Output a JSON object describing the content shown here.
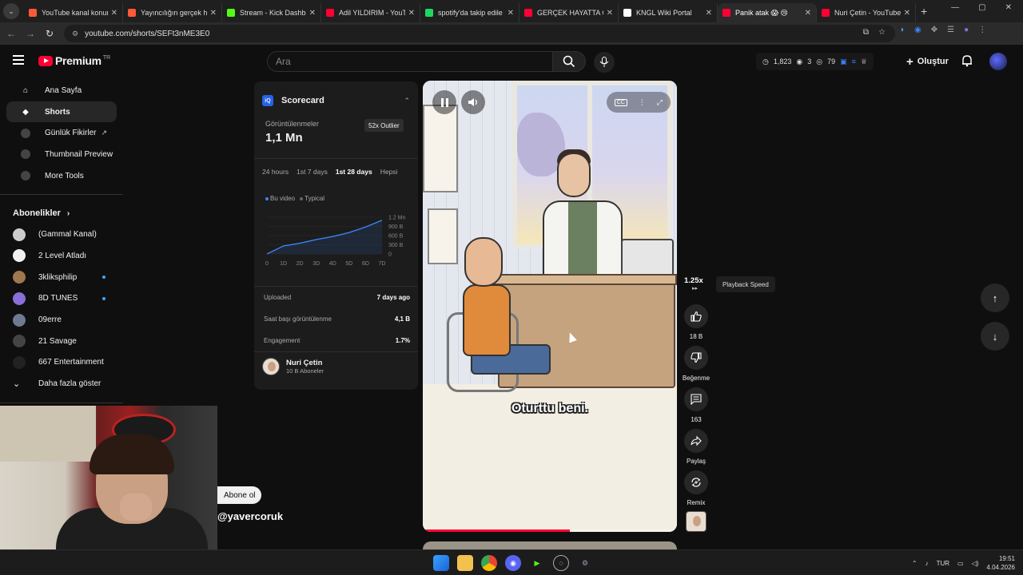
{
  "browser": {
    "tabs": [
      {
        "title": "YouTube kanal konum",
        "color": "#ff5a36"
      },
      {
        "title": "Yayıncılığın gerçek h",
        "color": "#ff5a36"
      },
      {
        "title": "Stream - Kick Dashbo",
        "color": "#53fc18"
      },
      {
        "title": "Adil YILDIRIM - YouTu",
        "color": "#ff0033"
      },
      {
        "title": "spotify'da takip edile",
        "color": "#1ed760"
      },
      {
        "title": "GERÇEK HAYATTA OY",
        "color": "#ff0033"
      },
      {
        "title": "KNGL Wiki Portal",
        "color": "#ffffff"
      },
      {
        "title": "Panik atak 😱 😢",
        "color": "#ff0033",
        "active": true
      },
      {
        "title": "Nuri Çetin - YouTube",
        "color": "#ff0033"
      }
    ],
    "url": "youtube.com/shorts/SEFt3nME3E0"
  },
  "header": {
    "logo_text": "Premium",
    "logo_country": "TR",
    "search_placeholder": "Ara",
    "stats": {
      "time": "1,823",
      "eye": "3",
      "views": "79"
    },
    "create_label": "Oluştur"
  },
  "sidebar": {
    "items": [
      {
        "label": "Ana Sayfa",
        "icon": "home-icon"
      },
      {
        "label": "Shorts",
        "icon": "shorts-icon"
      },
      {
        "label": "Günlük Fikirler",
        "icon": "tool-icon"
      },
      {
        "label": "Thumbnail Preview",
        "icon": "tool-icon"
      },
      {
        "label": "More Tools",
        "icon": "tool-icon"
      }
    ],
    "subs_title": "Abonelikler",
    "subs": [
      {
        "label": "(Gammal Kanal)",
        "color": "#cccccc"
      },
      {
        "label": "2 Level Atladı",
        "color": "#f1f1f1"
      },
      {
        "label": "3kliksphilip",
        "color": "#a07850",
        "dot": true
      },
      {
        "label": "8D TUNES",
        "color": "#8a6fd8",
        "dot": true
      },
      {
        "label": "09erre",
        "color": "#6e7a90"
      },
      {
        "label": "21 Savage",
        "color": "#444444"
      },
      {
        "label": "667 Entertainment",
        "color": "#222222"
      }
    ],
    "more_label": "Daha fazla göster"
  },
  "scorecard": {
    "title": "Scorecard",
    "views_label": "Görüntülenmeler",
    "views_value": "1,1 Mn",
    "outlier": "52x Outlier",
    "tabs": [
      "24 hours",
      "1st 7 days",
      "1st 28 days",
      "Hepsi"
    ],
    "active_tab": 2,
    "legend_video": "Bu video",
    "legend_typical": "Typical",
    "rows": [
      {
        "label": "Uploaded",
        "value": "7 days ago"
      },
      {
        "label": "Saat başı görüntülenme",
        "value": "4,1 B"
      },
      {
        "label": "Engagement",
        "value": "1.7%"
      }
    ],
    "channel_name": "Nuri Çetin",
    "channel_subs": "10 B Aboneler"
  },
  "chart_data": {
    "type": "line",
    "x": [
      "0",
      "1D",
      "2D",
      "3D",
      "4D",
      "5D",
      "6D",
      "7D"
    ],
    "y_ticks": [
      "1.2 Mn",
      "900 B",
      "600 B",
      "300 B",
      "0"
    ],
    "ylim": [
      0,
      1200000
    ],
    "series": [
      {
        "name": "Bu video",
        "values": [
          0,
          260000,
          350000,
          470000,
          570000,
          700000,
          880000,
          1100000
        ],
        "color": "#3b82f6"
      }
    ]
  },
  "short": {
    "caption": "Oturttu beni.",
    "progress": 0.58,
    "speed": "1.25x",
    "speed_tooltip": "Playback Speed",
    "likes": "18 B",
    "dislike_label": "Beğenme",
    "comments": "163",
    "share_label": "Paylaş",
    "remix_label": "Remix"
  },
  "overlay": {
    "subscribe_label": "Abone ol",
    "handle": "@yavercoruk"
  },
  "taskbar": {
    "lang": "TUR",
    "time": "19:51",
    "date": "4.04.2026"
  }
}
